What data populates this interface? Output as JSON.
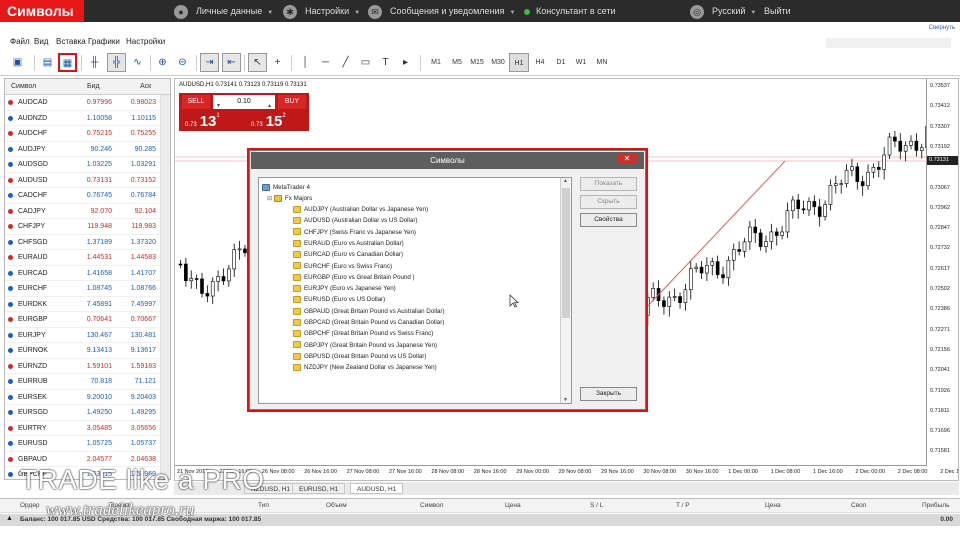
{
  "page_title": "Символы",
  "topbar": {
    "personal_data": "Личные данные",
    "settings": "Настройки",
    "messages": "Сообщения и уведомления",
    "online": "Консультант в сети",
    "language": "Русский",
    "logout": "Выйти"
  },
  "collapse_link": "Свернуть",
  "menu": [
    "Файл",
    "Вид",
    "Вставка",
    "Графики",
    "Настройки"
  ],
  "timeframes": [
    "M1",
    "M5",
    "M15",
    "M30",
    "H1",
    "H4",
    "D1",
    "W1",
    "MN"
  ],
  "active_timeframe": "H1",
  "watch": {
    "headers": {
      "symbol": "Символ",
      "bid": "Бид",
      "ask": "Аск"
    },
    "rows": [
      {
        "s": "AUDCAD",
        "b": "0.97996",
        "a": "0.98023",
        "c": "#d62828"
      },
      {
        "s": "AUDNZD",
        "b": "1.10058",
        "a": "1.10115",
        "c": "#1a5fc4"
      },
      {
        "s": "AUDCHF",
        "b": "0.75215",
        "a": "0.75255",
        "c": "#d62828"
      },
      {
        "s": "AUDJPY",
        "b": "90.246",
        "a": "90.285",
        "c": "#1a5fc4"
      },
      {
        "s": "AUDSGD",
        "b": "1.03225",
        "a": "1.03291",
        "c": "#1a5fc4"
      },
      {
        "s": "AUDUSD",
        "b": "0.73131",
        "a": "0.73152",
        "c": "#d62828"
      },
      {
        "s": "CADCHF",
        "b": "0.76745",
        "a": "0.76784",
        "c": "#1a5fc4"
      },
      {
        "s": "CADJPY",
        "b": "92.070",
        "a": "92.104",
        "c": "#d62828"
      },
      {
        "s": "CHFJPY",
        "b": "119.948",
        "a": "119.983",
        "c": "#d62828"
      },
      {
        "s": "CHFSGD",
        "b": "1.37189",
        "a": "1.37320",
        "c": "#1a5fc4"
      },
      {
        "s": "EURAUD",
        "b": "1.44531",
        "a": "1.44583",
        "c": "#d62828"
      },
      {
        "s": "EURCAD",
        "b": "1.41658",
        "a": "1.41707",
        "c": "#1a5fc4"
      },
      {
        "s": "EURCHF",
        "b": "1.08745",
        "a": "1.08766",
        "c": "#1a5fc4"
      },
      {
        "s": "EURDKK",
        "b": "7.45891",
        "a": "7.45997",
        "c": "#1a5fc4"
      },
      {
        "s": "EURGBP",
        "b": "0.70641",
        "a": "0.70667",
        "c": "#d62828"
      },
      {
        "s": "EURJPY",
        "b": "130.467",
        "a": "130.481",
        "c": "#1a5fc4"
      },
      {
        "s": "EURNOK",
        "b": "9.13413",
        "a": "9.13617",
        "c": "#1a5fc4"
      },
      {
        "s": "EURNZD",
        "b": "1.59101",
        "a": "1.59183",
        "c": "#d62828"
      },
      {
        "s": "EURRUB",
        "b": "70.818",
        "a": "71.121",
        "c": "#1a5fc4"
      },
      {
        "s": "EURSEK",
        "b": "9.20010",
        "a": "9.20403",
        "c": "#1a5fc4"
      },
      {
        "s": "EURSGD",
        "b": "1.49250",
        "a": "1.49295",
        "c": "#1a5fc4"
      },
      {
        "s": "EURTRY",
        "b": "3.05485",
        "a": "3.05656",
        "c": "#d62828"
      },
      {
        "s": "EURUSD",
        "b": "1.05725",
        "a": "1.05737",
        "c": "#1a5fc4"
      },
      {
        "s": "GBPAUD",
        "b": "2.04577",
        "a": "2.04638",
        "c": "#d62828"
      },
      {
        "s": "GBPCHF",
        "b": "1.53915",
        "a": "1.53969",
        "c": "#1a5fc4"
      }
    ]
  },
  "chart": {
    "header": "AUDUSD,H1  0.73141 0.73123 0.73119 0.73131",
    "sell": "SELL",
    "buy": "BUY",
    "volume": "0.10",
    "sell_price_small": "0.73",
    "sell_price_big": "13",
    "sell_price_sup": "1",
    "buy_price_small": "0.73",
    "buy_price_big": "15",
    "buy_price_sup": "2",
    "current_price": "0.73131",
    "price_labels": [
      "0.73537",
      "0.73412",
      "0.73307",
      "0.73192",
      "0.73131",
      "0.73067",
      "0.72962",
      "0.72847",
      "0.72732",
      "0.72617",
      "0.72502",
      "0.72386",
      "0.72271",
      "0.72156",
      "0.72041",
      "0.71926",
      "0.71811",
      "0.71696",
      "0.71581"
    ],
    "time_labels": [
      "21 Nov 2016",
      "23 Nov 16:00",
      "26 Nov 08:00",
      "26 Nov 16:00",
      "27 Nov 08:00",
      "27 Nov 16:00",
      "28 Nov 08:00",
      "28 Nov 16:00",
      "29 Nov 00:00",
      "29 Nov 08:00",
      "29 Nov 16:00",
      "30 Nov 08:00",
      "30 Nov 16:00",
      "1 Dec 00:00",
      "1 Dec 08:00",
      "1 Dec 16:00",
      "2 Dec 00:00",
      "2 Dec 08:00",
      "2 Dec 16:00"
    ],
    "tabs": [
      "NZDUSD, H1",
      "EURUSD, H1",
      "AUDUSD, H1"
    ],
    "active_tab": 2
  },
  "dialog": {
    "title": "Символы",
    "close": "✕",
    "root": "MetaTrader 4",
    "folder": "Fx Majors",
    "items": [
      "AUDJPY (Australian Dollar vs Japanese Yen)",
      "AUDUSD (Australian Dollar vs US Dollar)",
      "CHFJPY (Swiss Franc vs Japanese Yen)",
      "EURAUD (Euro vs Australian Dollar)",
      "EURCAD (Euro vs Canadian Dollar)",
      "EURCHF (Euro vs Swiss Franc)",
      "EURGBP (Euro vs Great Britain Pound )",
      "EURJPY (Euro vs Japanese Yen)",
      "EURUSD (Euro vs US Dollar)",
      "GBPAUD (Great Britain Pound vs Australian Dollar)",
      "GBPCAD (Great Britain Pound vs Canadian Dollar)",
      "GBPCHF (Great Britain Pound vs Swiss Franc)",
      "GBPJPY (Great Britain Pound vs Japanese Yen)",
      "GBPUSD (Great Britain Pound vs US Dollar)",
      "NZDJPY (New Zealand Dollar vs Japanese Yen)"
    ],
    "btn_show": "Показать",
    "btn_hide": "Скрыть",
    "btn_props": "Свойства",
    "btn_close": "Закрыть"
  },
  "terminal": {
    "headers": [
      "Ордер",
      "Время",
      "Тип",
      "Объем",
      "Символ",
      "Цена",
      "S / L",
      "T / P",
      "Цена",
      "Своп",
      "Прибыль"
    ],
    "balance": "Баланс: 100 017.85 USD  Средства: 100 017.85  Свободная маржа: 100 017.85",
    "profit": "0.00"
  },
  "watermark": {
    "logo": "TRADE like a PRO",
    "url": "www.tradelikeapro.ru"
  },
  "colors": {
    "brand_red": "#e81818",
    "bid_down": "#d62828",
    "bid_up": "#1a5fc4"
  }
}
